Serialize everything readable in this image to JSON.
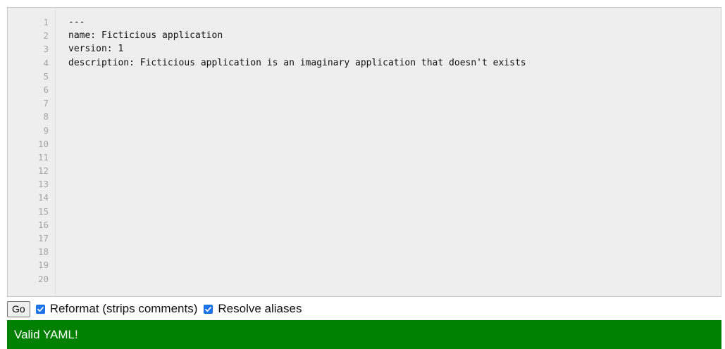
{
  "editor": {
    "line_numbers": [
      "1",
      "2",
      "3",
      "4",
      "5",
      "6",
      "7",
      "8",
      "9",
      "10",
      "11",
      "12",
      "13",
      "14",
      "15",
      "16",
      "17",
      "18",
      "19",
      "20"
    ],
    "lines": [
      "---",
      "name: Ficticious application",
      "version: 1",
      "description: Ficticious application is an imaginary application that doesn't exists"
    ]
  },
  "controls": {
    "go_label": "Go",
    "reformat": {
      "label": "Reformat (strips comments)",
      "checked": true
    },
    "resolve_aliases": {
      "label": "Resolve aliases",
      "checked": true
    }
  },
  "status": {
    "text": "Valid YAML!",
    "color": "#008000"
  },
  "colors": {
    "checkbox": "#1a73e8",
    "editor_bg": "#eeeeee"
  }
}
